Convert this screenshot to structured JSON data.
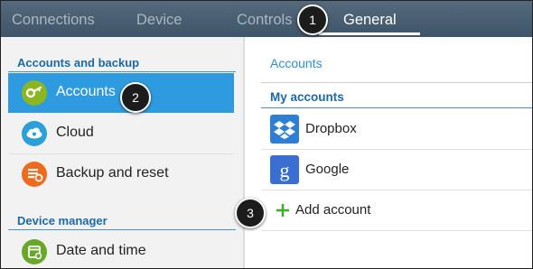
{
  "tabs": [
    {
      "label": "Connections",
      "active": false
    },
    {
      "label": "Device",
      "active": false
    },
    {
      "label": "Controls",
      "active": false
    },
    {
      "label": "General",
      "active": true
    }
  ],
  "sidebar": {
    "sections": [
      {
        "title": "Accounts and backup"
      },
      {
        "title": "Device manager"
      }
    ],
    "items": [
      {
        "label": "Accounts",
        "icon": "key-icon",
        "color": "#8bb61f",
        "selected": true
      },
      {
        "label": "Cloud",
        "icon": "cloud-icon",
        "color": "#2a9fd8",
        "selected": false
      },
      {
        "label": "Backup and reset",
        "icon": "backup-icon",
        "color": "#f06a1e",
        "selected": false
      },
      {
        "label": "Date and time",
        "icon": "calendar-icon",
        "color": "#6aa62a",
        "selected": false
      }
    ]
  },
  "main": {
    "breadcrumb": "Accounts",
    "section_title": "My accounts",
    "accounts": [
      {
        "label": "Dropbox",
        "icon": "dropbox-icon",
        "color": "#2d7fd6"
      },
      {
        "label": "Google",
        "icon": "google-icon",
        "color": "#3a6fd1"
      }
    ],
    "add_account_label": "Add account"
  },
  "callouts": [
    "1",
    "2",
    "3"
  ],
  "colors": {
    "accent": "#2e9be0",
    "section_text": "#1b6aa5",
    "tabbar": "#4a5f72"
  }
}
